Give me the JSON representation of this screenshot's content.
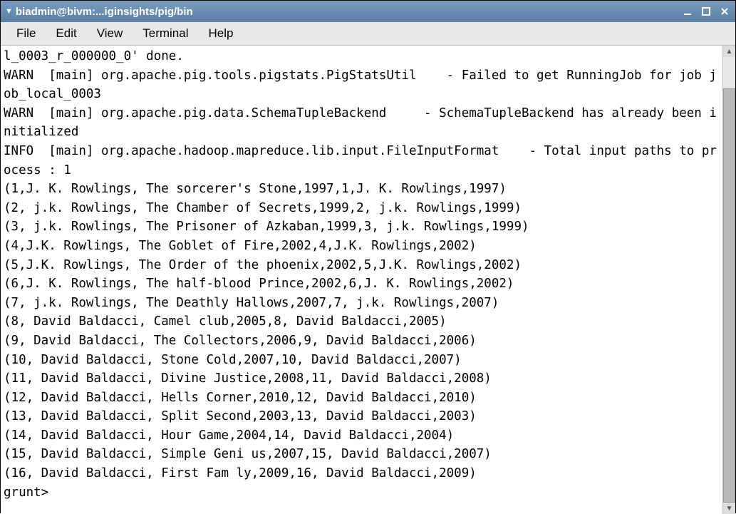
{
  "titlebar": {
    "title": "biadmin@bivm:...iginsights/pig/bin"
  },
  "menubar": {
    "file": "File",
    "edit": "Edit",
    "view": "View",
    "terminal": "Terminal",
    "help": "Help"
  },
  "terminal": {
    "output": "l_0003_r_000000_0' done.\nWARN  [main] org.apache.pig.tools.pigstats.PigStatsUtil    - Failed to get RunningJob for job job_local_0003\nWARN  [main] org.apache.pig.data.SchemaTupleBackend     - SchemaTupleBackend has already been initialized\nINFO  [main] org.apache.hadoop.mapreduce.lib.input.FileInputFormat    - Total input paths to process : 1\n(1,J. K. Rowlings, The sorcerer's Stone,1997,1,J. K. Rowlings,1997)\n(2, j.k. Rowlings, The Chamber of Secrets,1999,2, j.k. Rowlings,1999)\n(3, j.k. Rowlings, The Prisoner of Azkaban,1999,3, j.k. Rowlings,1999)\n(4,J.K. Rowlings, The Goblet of Fire,2002,4,J.K. Rowlings,2002)\n(5,J.K. Rowlings, The Order of the phoenix,2002,5,J.K. Rowlings,2002)\n(6,J. K. Rowlings, The half-blood Prince,2002,6,J. K. Rowlings,2002)\n(7, j.k. Rowlings, The Deathly Hallows,2007,7, j.k. Rowlings,2007)\n(8, David Baldacci, Camel club,2005,8, David Baldacci,2005)\n(9, David Baldacci, The Collectors,2006,9, David Baldacci,2006)\n(10, David Baldacci, Stone Cold,2007,10, David Baldacci,2007)\n(11, David Baldacci, Divine Justice,2008,11, David Baldacci,2008)\n(12, David Baldacci, Hells Corner,2010,12, David Baldacci,2010)\n(13, David Baldacci, Split Second,2003,13, David Baldacci,2003)\n(14, David Baldacci, Hour Game,2004,14, David Baldacci,2004)\n(15, David Baldacci, Simple Geni us,2007,15, David Baldacci,2007)\n(16, David Baldacci, First Fam ly,2009,16, David Baldacci,2009)\ngrunt> "
  }
}
